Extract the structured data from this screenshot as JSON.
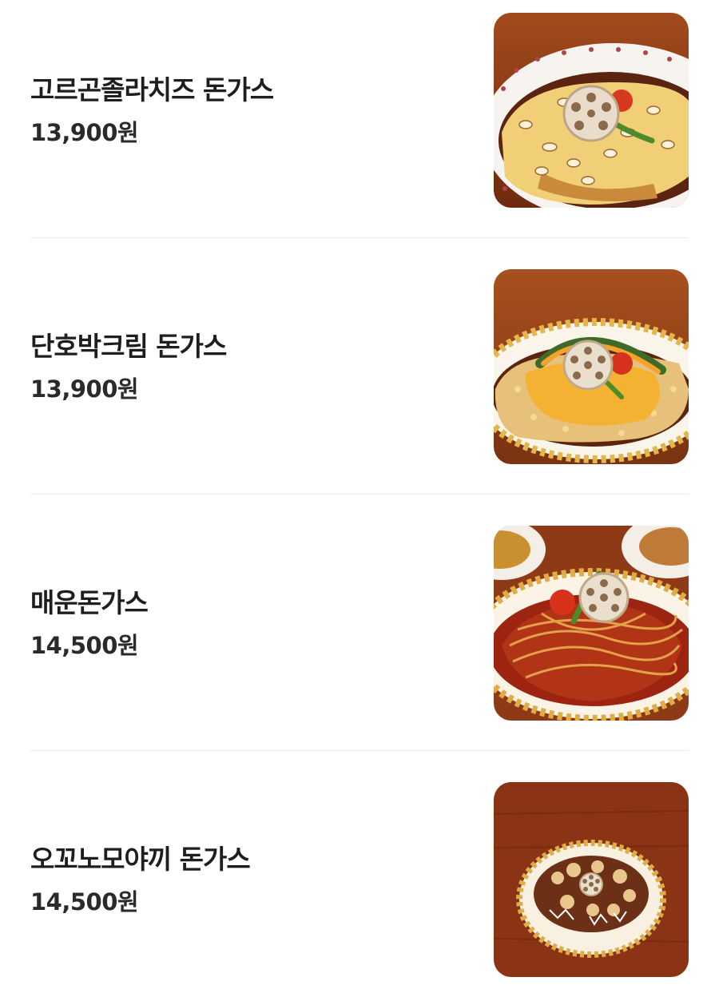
{
  "menu": {
    "items": [
      {
        "name": "고르곤졸라치즈 돈가스",
        "price": "13,900원",
        "image_icon": "gorgonzola-cheese-tonkatsu-photo"
      },
      {
        "name": "단호박크림 돈가스",
        "price": "13,900원",
        "image_icon": "pumpkin-cream-tonkatsu-photo"
      },
      {
        "name": "매운돈가스",
        "price": "14,500원",
        "image_icon": "spicy-tonkatsu-photo"
      },
      {
        "name": "오꼬노모야끼 돈가스",
        "price": "14,500원",
        "image_icon": "okonomiyaki-tonkatsu-photo"
      }
    ]
  },
  "colors": {
    "text_primary": "#1e1e1e",
    "divider": "#ececec",
    "table_wood": "#8a3a17"
  }
}
